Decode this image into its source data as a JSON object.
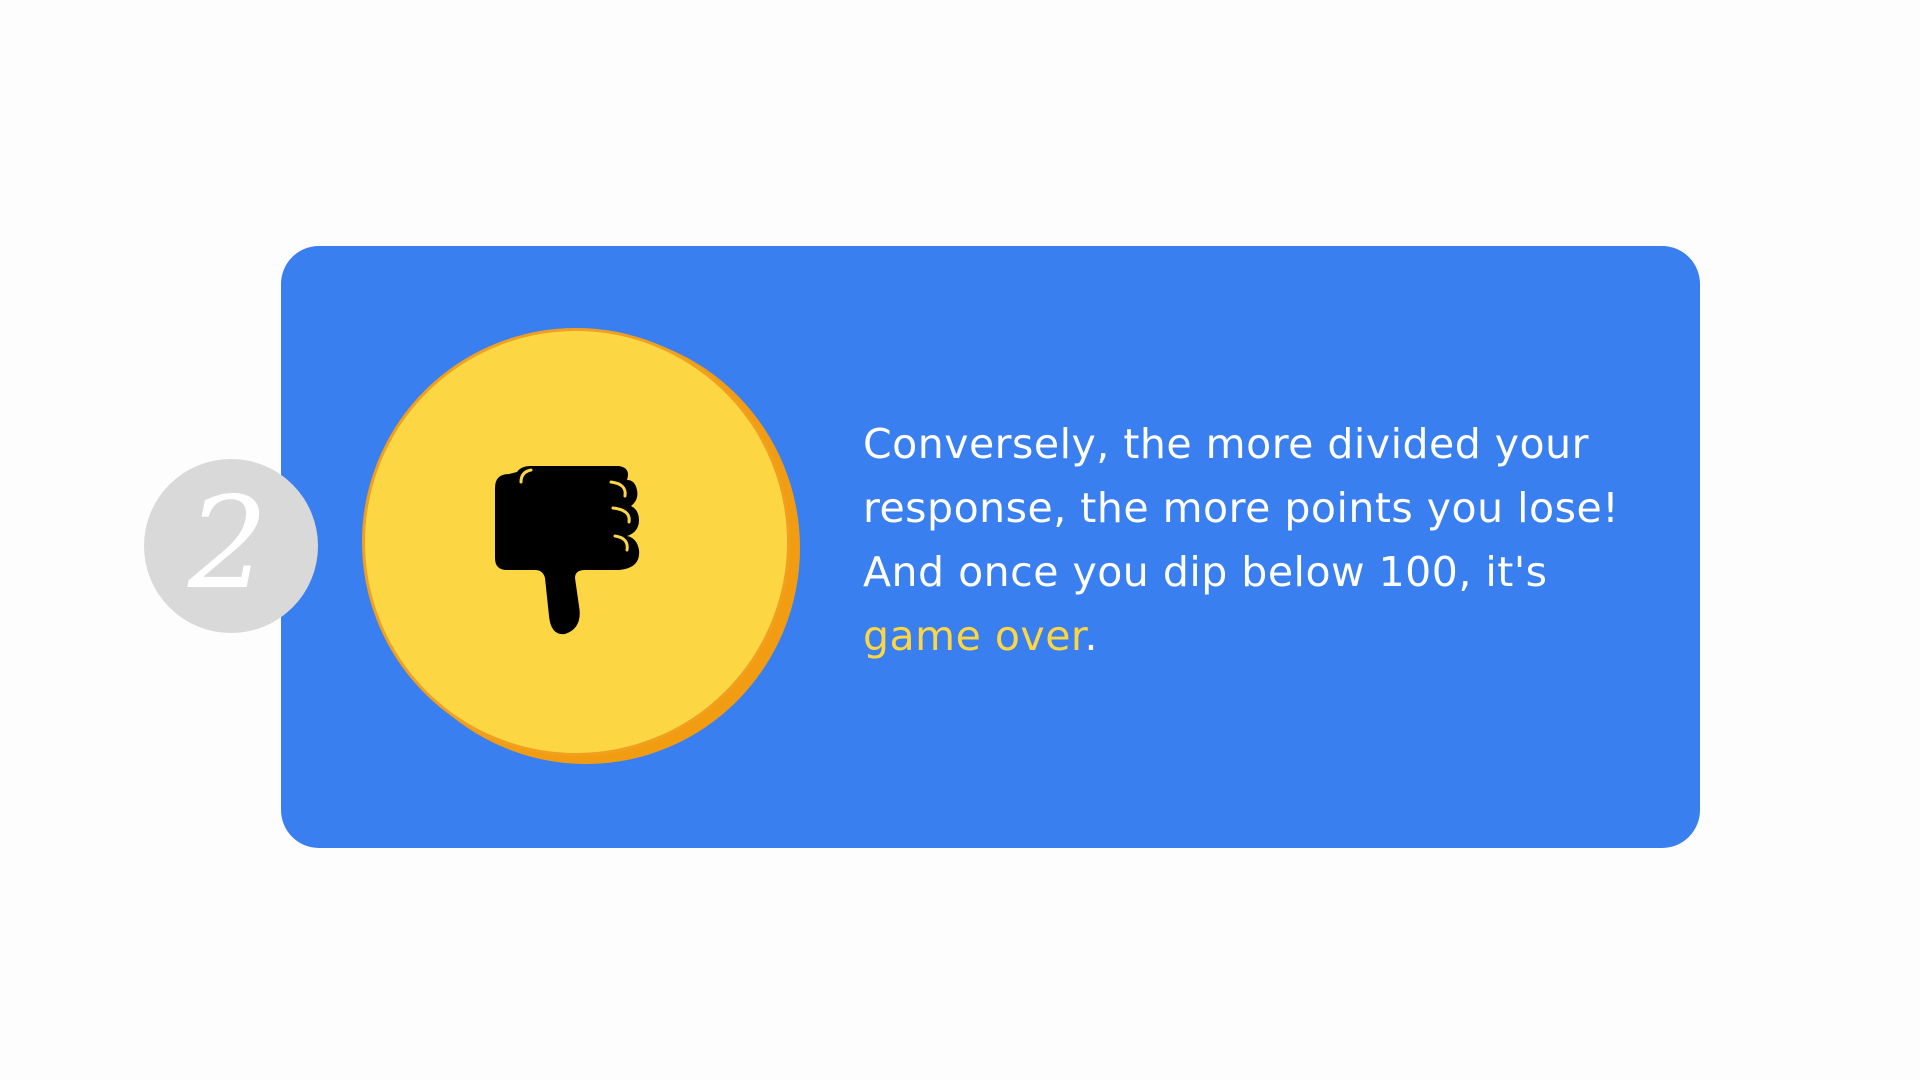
{
  "step": {
    "number": "2"
  },
  "icon": {
    "name": "thumbs-down-icon"
  },
  "message": {
    "text_before": "Conversely, the more divided your response, the more points you lose! And once you dip below 100, it's ",
    "highlight": "game over",
    "text_after": "."
  },
  "colors": {
    "card_background": "#3a7fef",
    "coin_fill": "#fdd643",
    "coin_shadow": "#f29c12",
    "badge_background": "#d9d9d9",
    "highlight_text": "#fdd643",
    "body_text": "#ffffff"
  }
}
